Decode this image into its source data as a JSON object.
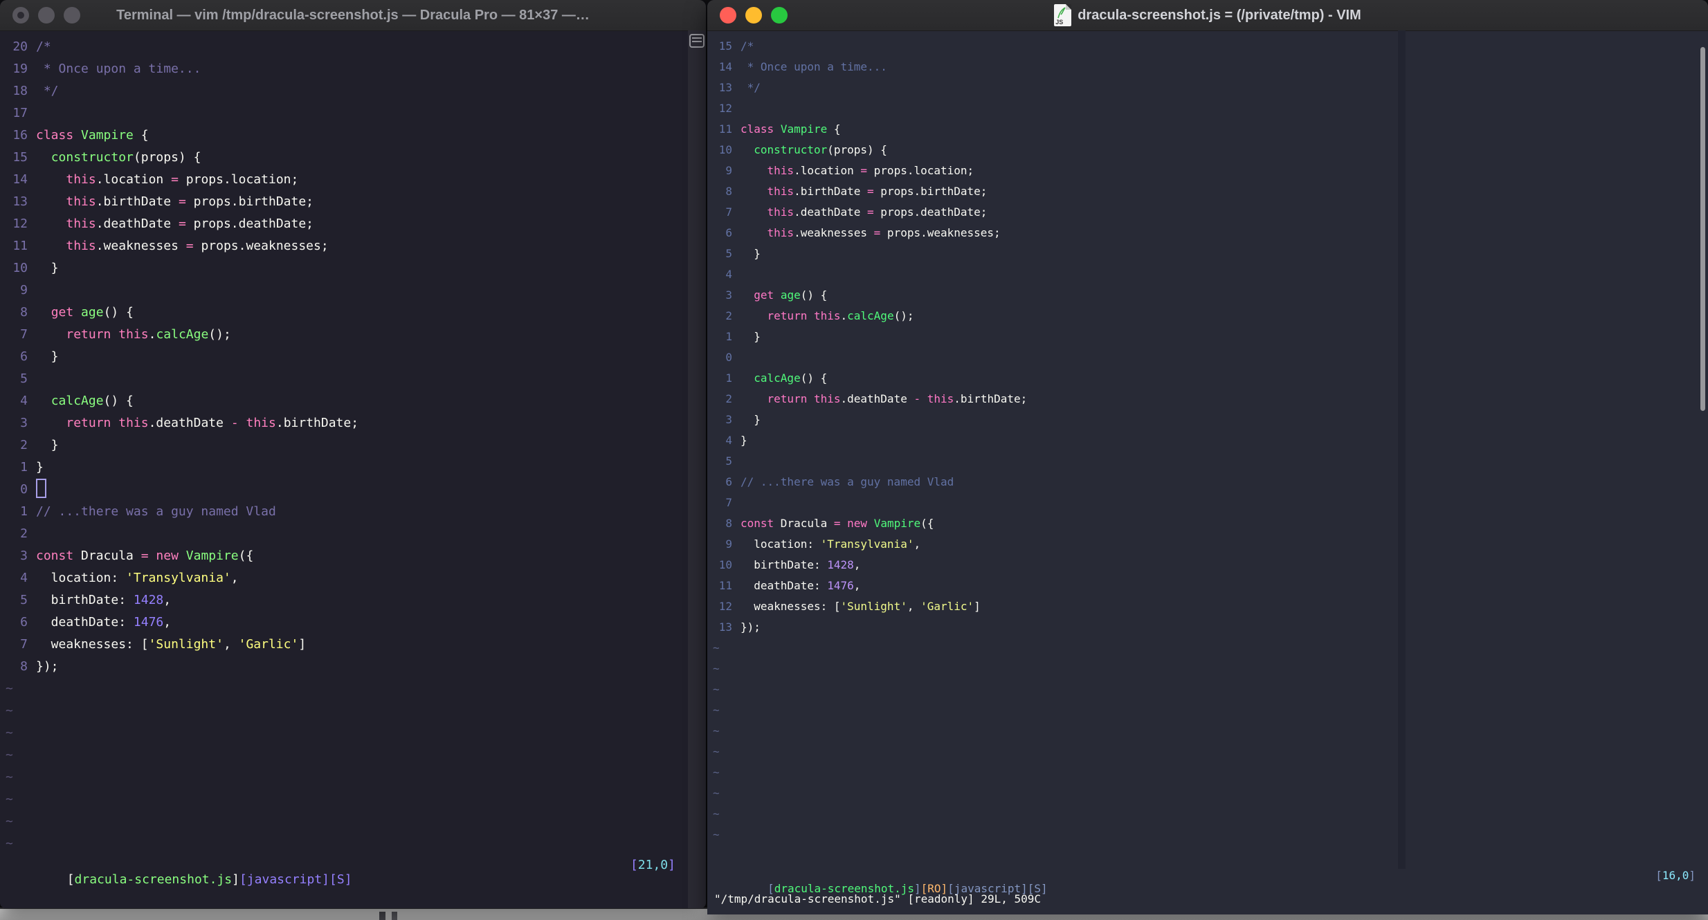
{
  "left_window": {
    "title": "Terminal — vim /tmp/dracula-screenshot.js — Dracula Pro — 81×37 —…",
    "palette": {
      "f": "#f8f8f2",
      "c": "#7970a9",
      "p": "#ff80bf",
      "g": "#8aff80",
      "y": "#ffff80",
      "u": "#9580ff",
      "n": "#7970a9",
      "t": "#585274",
      "cy": "#7edce8"
    },
    "line_numbers": [
      "20",
      "19",
      "18",
      "17",
      "16",
      "15",
      "14",
      "13",
      "12",
      "11",
      "10",
      "9",
      "8",
      "7",
      "6",
      "5",
      "4",
      "3",
      "2",
      "1",
      "0",
      "1",
      "2",
      "3",
      "4",
      "5",
      "6",
      "7",
      "8"
    ],
    "cursor_row": 20,
    "tilde_count": 8,
    "status_left": [
      [
        "[",
        "f"
      ],
      [
        "dracula-screenshot.js",
        "g"
      ],
      [
        "]",
        "f"
      ],
      [
        "[javascript]",
        "u"
      ],
      [
        "[S]",
        "u"
      ]
    ],
    "status_right": [
      [
        "[",
        "u"
      ],
      [
        "21,0",
        "cy"
      ],
      [
        "]",
        "u"
      ]
    ]
  },
  "right_window": {
    "title": "dracula-screenshot.js = (/private/tmp) - VIM",
    "doc_icon_label": "JS",
    "palette": {
      "f": "#f8f8f2",
      "c": "#6272a4",
      "p": "#ff79c6",
      "g": "#50fa7b",
      "y": "#f1fa8c",
      "u": "#bd93f9",
      "n": "#6272a4",
      "t": "#5a6287",
      "cy": "#8be9fd",
      "o": "#ffb86c",
      "sb": "#8497c2"
    },
    "line_numbers": [
      "15",
      "14",
      "13",
      "12",
      "11",
      "10",
      "9",
      "8",
      "7",
      "6",
      "5",
      "4",
      "3",
      "2",
      "1",
      "0",
      "1",
      "2",
      "3",
      "4",
      "5",
      "6",
      "7",
      "8",
      "9",
      "10",
      "11",
      "12",
      "13"
    ],
    "cursor_row": null,
    "tilde_count": 10,
    "status_left": [
      [
        "[",
        "sb"
      ],
      [
        "dracula-screenshot.js",
        "g"
      ],
      [
        "]",
        "sb"
      ],
      [
        "[RO]",
        "o"
      ],
      [
        "[javascript]",
        "sb"
      ],
      [
        "[S]",
        "sb"
      ]
    ],
    "status_right": [
      [
        "[",
        "sb"
      ],
      [
        "16,0",
        "cy"
      ],
      [
        "]",
        "sb"
      ]
    ],
    "cmdline": "\"/tmp/dracula-screenshot.js\" [readonly] 29L, 509C"
  },
  "code_lines": [
    [
      [
        "/*",
        "c"
      ]
    ],
    [
      [
        " * Once upon a time...",
        "c"
      ]
    ],
    [
      [
        " */",
        "c"
      ]
    ],
    [],
    [
      [
        "class",
        "p"
      ],
      [
        " ",
        "f"
      ],
      [
        "Vampire",
        "g"
      ],
      [
        " {",
        "f"
      ]
    ],
    [
      [
        "  ",
        "f"
      ],
      [
        "constructor",
        "g"
      ],
      [
        "(props) {",
        "f"
      ]
    ],
    [
      [
        "    ",
        "f"
      ],
      [
        "this",
        "p"
      ],
      [
        ".location ",
        "f"
      ],
      [
        "=",
        "p"
      ],
      [
        " props.location;",
        "f"
      ]
    ],
    [
      [
        "    ",
        "f"
      ],
      [
        "this",
        "p"
      ],
      [
        ".birthDate ",
        "f"
      ],
      [
        "=",
        "p"
      ],
      [
        " props.birthDate;",
        "f"
      ]
    ],
    [
      [
        "    ",
        "f"
      ],
      [
        "this",
        "p"
      ],
      [
        ".deathDate ",
        "f"
      ],
      [
        "=",
        "p"
      ],
      [
        " props.deathDate;",
        "f"
      ]
    ],
    [
      [
        "    ",
        "f"
      ],
      [
        "this",
        "p"
      ],
      [
        ".weaknesses ",
        "f"
      ],
      [
        "=",
        "p"
      ],
      [
        " props.weaknesses;",
        "f"
      ]
    ],
    [
      [
        "  }",
        "f"
      ]
    ],
    [],
    [
      [
        "  ",
        "f"
      ],
      [
        "get",
        "p"
      ],
      [
        " ",
        "f"
      ],
      [
        "age",
        "g"
      ],
      [
        "() {",
        "f"
      ]
    ],
    [
      [
        "    ",
        "f"
      ],
      [
        "return",
        "p"
      ],
      [
        " ",
        "f"
      ],
      [
        "this",
        "p"
      ],
      [
        ".",
        "f"
      ],
      [
        "calcAge",
        "g"
      ],
      [
        "();",
        "f"
      ]
    ],
    [
      [
        "  }",
        "f"
      ]
    ],
    [],
    [
      [
        "  ",
        "f"
      ],
      [
        "calcAge",
        "g"
      ],
      [
        "() {",
        "f"
      ]
    ],
    [
      [
        "    ",
        "f"
      ],
      [
        "return",
        "p"
      ],
      [
        " ",
        "f"
      ],
      [
        "this",
        "p"
      ],
      [
        ".deathDate ",
        "f"
      ],
      [
        "-",
        "p"
      ],
      [
        " ",
        "f"
      ],
      [
        "this",
        "p"
      ],
      [
        ".birthDate;",
        "f"
      ]
    ],
    [
      [
        "  }",
        "f"
      ]
    ],
    [
      [
        "}",
        "f"
      ]
    ],
    [],
    [
      [
        "// ...there was a guy named Vlad",
        "c"
      ]
    ],
    [],
    [
      [
        "const",
        "p"
      ],
      [
        " Dracula ",
        "f"
      ],
      [
        "=",
        "p"
      ],
      [
        " ",
        "f"
      ],
      [
        "new",
        "p"
      ],
      [
        " ",
        "f"
      ],
      [
        "Vampire",
        "g"
      ],
      [
        "({",
        "f"
      ]
    ],
    [
      [
        "  location: ",
        "f"
      ],
      [
        "'Transylvania'",
        "y"
      ],
      [
        ",",
        "f"
      ]
    ],
    [
      [
        "  birthDate: ",
        "f"
      ],
      [
        "1428",
        "u"
      ],
      [
        ",",
        "f"
      ]
    ],
    [
      [
        "  deathDate: ",
        "f"
      ],
      [
        "1476",
        "u"
      ],
      [
        ",",
        "f"
      ]
    ],
    [
      [
        "  weaknesses: [",
        "f"
      ],
      [
        "'Sunlight'",
        "y"
      ],
      [
        ", ",
        "f"
      ],
      [
        "'Garlic'",
        "y"
      ],
      [
        "]",
        "f"
      ]
    ],
    [
      [
        "});",
        "f"
      ]
    ]
  ]
}
